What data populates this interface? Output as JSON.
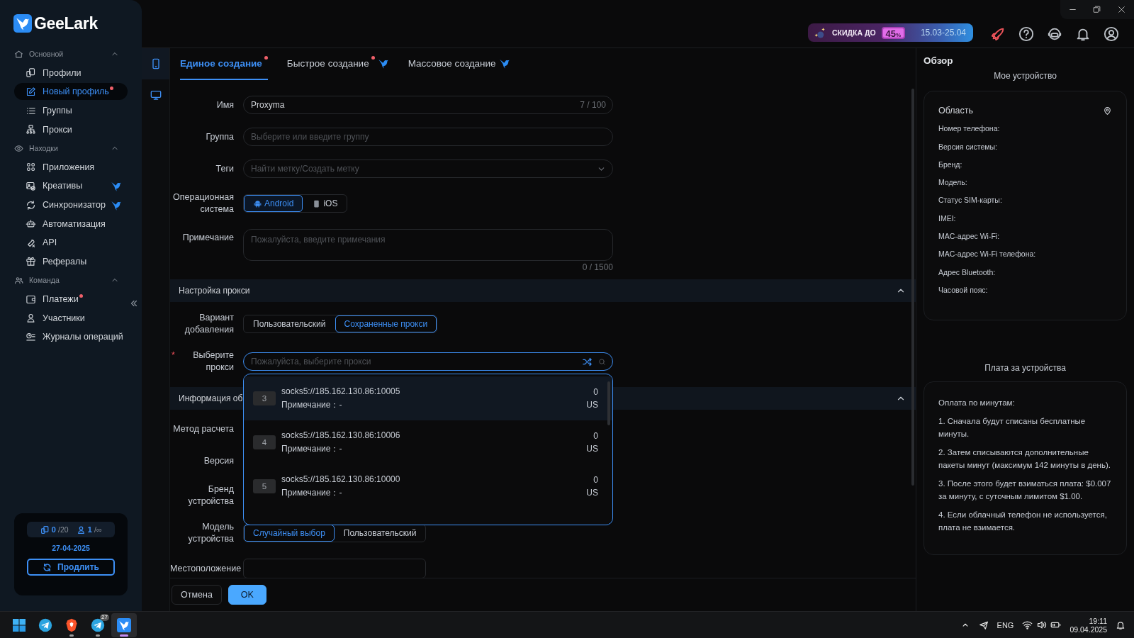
{
  "sidebar": {
    "logo": "GeeLark",
    "sections": [
      {
        "title": "Основной",
        "expanded": true,
        "items": [
          {
            "label": "Профили",
            "selected": false,
            "dot": false,
            "pro": false
          },
          {
            "label": "Новый профиль",
            "selected": true,
            "dot": true,
            "pro": false
          },
          {
            "label": "Группы",
            "selected": false,
            "dot": false,
            "pro": false
          },
          {
            "label": "Прокси",
            "selected": false,
            "dot": false,
            "pro": false
          }
        ]
      },
      {
        "title": "Находки",
        "expanded": true,
        "items": [
          {
            "label": "Приложения",
            "selected": false,
            "dot": false,
            "pro": false
          },
          {
            "label": "Креативы",
            "selected": false,
            "dot": false,
            "pro": true
          },
          {
            "label": "Синхронизатор",
            "selected": false,
            "dot": false,
            "pro": true
          },
          {
            "label": "Автоматизация",
            "selected": false,
            "dot": false,
            "pro": false
          },
          {
            "label": "API",
            "selected": false,
            "dot": false,
            "pro": false
          },
          {
            "label": "Рефералы",
            "selected": false,
            "dot": false,
            "pro": false
          }
        ]
      },
      {
        "title": "Команда",
        "expanded": true,
        "items": [
          {
            "label": "Платежи",
            "selected": false,
            "dot": true,
            "pro": false
          },
          {
            "label": "Участники",
            "selected": false,
            "dot": false,
            "pro": false
          },
          {
            "label": "Журналы операций",
            "selected": false,
            "dot": false,
            "pro": false
          }
        ]
      }
    ],
    "plan": {
      "devices_used": "0",
      "devices_limit": "/20",
      "members_used": "1",
      "members_limit": "/∞",
      "expires": "27-04-2025",
      "renew": "Продлить"
    }
  },
  "promo": {
    "label": "СКИДКА ДО",
    "discount": "45",
    "unit": "%",
    "dates": "15.03-25.04"
  },
  "device_modes": [
    {
      "kind": "phone",
      "selected": true
    },
    {
      "kind": "desktop",
      "selected": false
    }
  ],
  "tabs": [
    {
      "label": "Единое создание",
      "selected": true,
      "dot": true,
      "pro": false
    },
    {
      "label": "Быстрое создание",
      "selected": false,
      "dot": true,
      "pro": true
    },
    {
      "label": "Массовое создание",
      "selected": false,
      "dot": false,
      "pro": true
    }
  ],
  "form": {
    "fields": [
      {
        "kind": "text",
        "label": "Имя",
        "value": "Proxyma",
        "counter": "7 / 100"
      },
      {
        "kind": "select",
        "label": "Группа",
        "placeholder": "Выберите или введите группу"
      },
      {
        "kind": "tags",
        "label": "Теги",
        "placeholder": "Найти метку/Создать метку"
      },
      {
        "kind": "segmented",
        "label": "Операционная система",
        "options": [
          {
            "kind": "android",
            "label": "Android",
            "selected": true
          },
          {
            "kind": "ios",
            "label": "iOS",
            "selected": false
          }
        ]
      },
      {
        "kind": "textarea",
        "label": "Примечание",
        "placeholder": "Пожалуйста, введите примечания",
        "counter": "0 / 1500"
      }
    ],
    "sections": [
      {
        "title": "Настройка прокси",
        "expanded": true,
        "fields": [
          {
            "kind": "segmented",
            "label": "Вариант добавления",
            "options": [
              {
                "label": "Пользовательский",
                "selected": false
              },
              {
                "label": "Сохраненные прокси",
                "selected": true
              }
            ]
          },
          {
            "kind": "proxy_select",
            "label": "Выберите прокси",
            "required_mark": "*",
            "placeholder": "Пожалуйста, выберите прокси",
            "dropdown": [
              {
                "index": "3",
                "address": "socks5://185.162.130.86:10005",
                "note": "Примечание：-",
                "count": "0",
                "country": "US",
                "highlighted": true
              },
              {
                "index": "4",
                "address": "socks5://185.162.130.86:10006",
                "note": "Примечание：-",
                "count": "0",
                "country": "US",
                "highlighted": false
              },
              {
                "index": "5",
                "address": "socks5://185.162.130.86:10000",
                "note": "Примечание：-",
                "count": "0",
                "country": "US",
                "highlighted": false
              }
            ]
          }
        ]
      },
      {
        "title": "Информация об",
        "expanded": true,
        "fields": [
          {
            "kind": "covered",
            "label": "Метод расчета"
          },
          {
            "kind": "covered",
            "label": "Версия"
          },
          {
            "kind": "covered",
            "label": "Бренд устройства"
          },
          {
            "kind": "segmented",
            "label": "Модель устройства",
            "options": [
              {
                "label": "Случайный выбор",
                "selected": true
              },
              {
                "label": "Пользовательский",
                "selected": false
              }
            ]
          },
          {
            "kind": "segmented",
            "label": "Местоположение"
          }
        ]
      }
    ]
  },
  "footer": {
    "cancel": "Отмена",
    "ok": "OK"
  },
  "overview": {
    "title": "Обзор",
    "device_title": "Мое устройство",
    "region": "Область",
    "fields": [
      "Номер телефона:",
      "Версия системы:",
      "Бренд:",
      "Модель:",
      "Статус SIM-карты:",
      "IMEI:",
      "MAC-адрес Wi-Fi:",
      "MAC-адрес Wi-Fi телефона:",
      "Адрес Bluetooth:",
      "Часовой пояс:"
    ],
    "fee_title": "Плата за устройства",
    "fee_heading": "Оплата по минутам:",
    "fee_lines": [
      "1. Сначала будут списаны бесплатные минуты.",
      "2. Затем списываются дополнительные пакеты минут (максимум 142 минуты в день).",
      "3. После этого будет взиматься плата: $0.007 за минуту, с суточным лимитом $1.00.",
      "4. Если облачный телефон не используется, плата не взимается."
    ]
  },
  "taskbar": {
    "apps": [
      {
        "kind": "windows",
        "running": false,
        "active": false
      },
      {
        "kind": "telegram",
        "running": false,
        "active": false
      },
      {
        "kind": "brave",
        "running": true,
        "active": false
      },
      {
        "kind": "telegram",
        "running": true,
        "active": false,
        "badge": "27"
      },
      {
        "kind": "geelark",
        "running": true,
        "active": true
      }
    ],
    "tray": {
      "language": "ENG",
      "time": "19:11",
      "date": "09.04.2025"
    }
  }
}
